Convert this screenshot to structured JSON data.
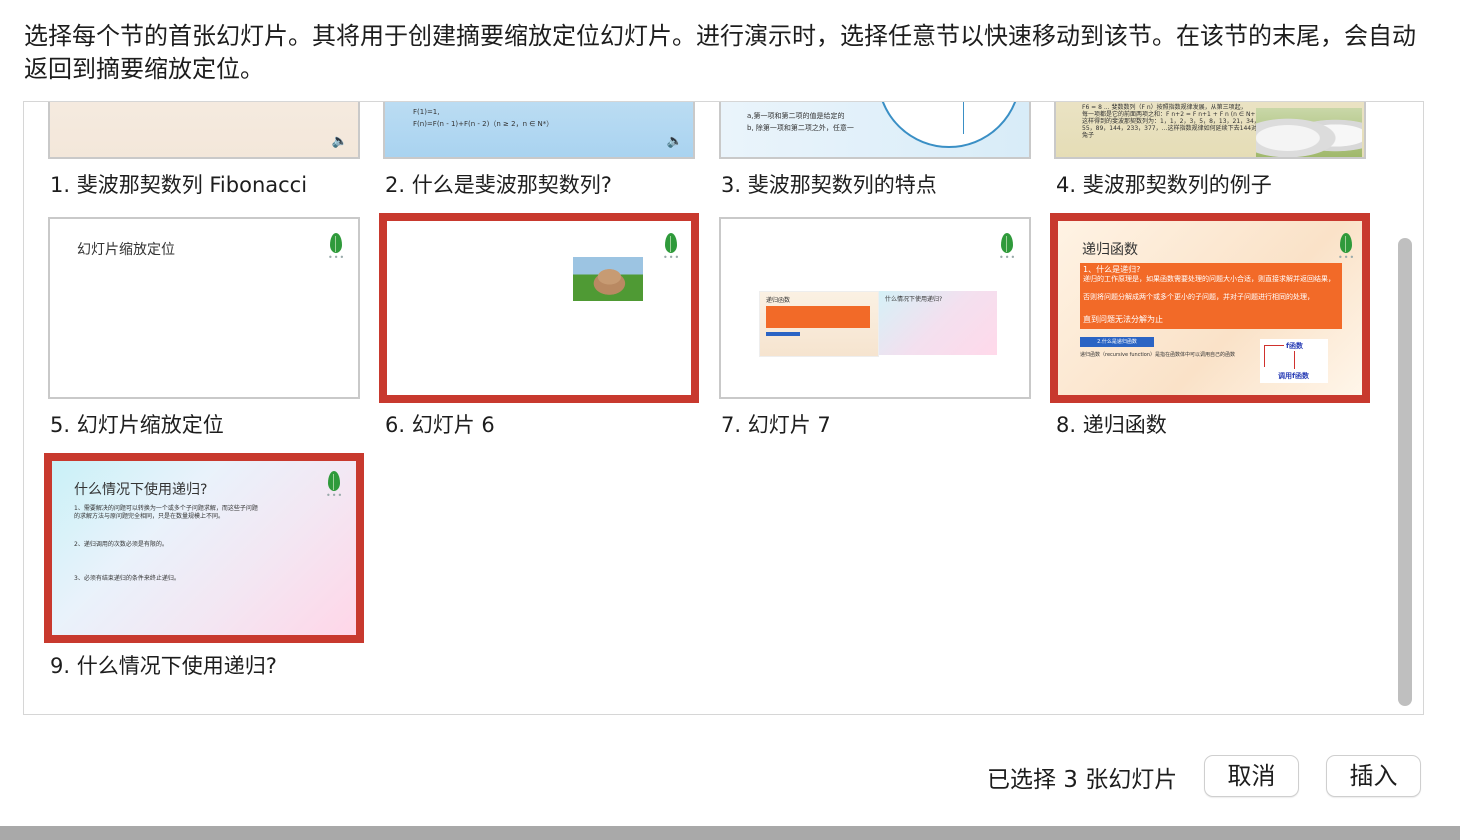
{
  "instruction": "选择每个节的首张幻灯片。其将用于创建摘要缩放定位幻灯片。进行演示时，选择任意节以快速移动到该节。在该节的末尾，会自动返回到摘要缩放定位。",
  "slides": [
    {
      "caption": "1. 斐波那契数列 Fibonacci",
      "selected": false
    },
    {
      "caption": "2. 什么是斐波那契数列?",
      "selected": false,
      "thumb_lines": [
        "F(1)=1,",
        "F(n)=F(n - 1)+F(n - 2)（n ≥ 2，n ∈ N*）"
      ]
    },
    {
      "caption": "3. 斐波那契数列的特点",
      "selected": false,
      "thumb_lines": [
        "a,第一项和第二项的值是给定的",
        "b, 除第一项和第二项之外，任意一"
      ]
    },
    {
      "caption": "4. 斐波那契数列的例子",
      "selected": false,
      "thumb_lines": [
        "F6 = 8 ... 斐数数列（F n）按照指数规律发展，从第三项起，",
        "每一项都是它的前面两项之和：F n+2 = F n+1 + F n (n ∈ N+)，",
        "这样得到的斐波那契数列为：1，1，2，3，5，8，13，21，34，",
        "55，89，144，233，377，…这样指数规律如何延续下去144对",
        "兔子"
      ]
    },
    {
      "caption": "5. 幻灯片缩放定位",
      "selected": false,
      "thumb_title": "幻灯片缩放定位"
    },
    {
      "caption": "6. 幻灯片 6",
      "selected": true
    },
    {
      "caption": "7. 幻灯片 7",
      "selected": false,
      "thumb_left_title": "递归函数",
      "thumb_right_title": "什么情况下使用递归?"
    },
    {
      "caption": "8. 递归函数",
      "selected": true,
      "thumb_title": "递归函数",
      "thumb_lines": [
        "1、什么是递归?",
        "递归的工作原理是，如果函数需要处理的问题大小合适，则直接求解并返回结果，",
        "否则将问题分解成两个或多个更小的子问题，并对子问题进行相同的处理，",
        "直到问题无法分解为止"
      ],
      "thumb_button": "2.什么是递归函数",
      "thumb_note": "递归函数（recursive function）是指在函数体中可以调用自己的函数",
      "thumb_diagram_top": "f函数",
      "thumb_diagram_bottom": "调用f函数"
    },
    {
      "caption": "9. 什么情况下使用递归?",
      "selected": true,
      "thumb_title": "什么情况下使用递归?",
      "thumb_lines": [
        "1、需要解决的问题可以转换为一个或多个子问题求解，而这些子问题",
        "的求解方法与原问题完全相同，只是在数量规模上不同。",
        "2、递归调用的次数必须是有限的。",
        "3、必须有结束递归的条件来终止递归。"
      ]
    }
  ],
  "footer": {
    "selected_count": "已选择 3 张幻灯片",
    "cancel_label": "取消",
    "insert_label": "插入"
  },
  "colors": {
    "selection_border": "#c8392e",
    "accent_orange": "#f26a28",
    "leaf_green": "#2f9a3b"
  }
}
